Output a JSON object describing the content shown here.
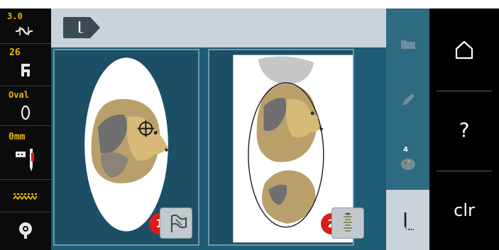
{
  "sidebar": {
    "items": [
      {
        "value": "3.0",
        "icon": "stitch-length-icon"
      },
      {
        "value": "26",
        "icon": "presser-foot-icon"
      },
      {
        "value": "Oval",
        "icon": "hoop-oval-icon"
      },
      {
        "value": "0mm",
        "icon": "needle-position-icon"
      },
      {
        "value": "",
        "icon": "feed-dog-icon"
      },
      {
        "value": "",
        "icon": "bobbin-icon"
      }
    ]
  },
  "right_column": {
    "badge_count": "4"
  },
  "panels": {
    "left": {
      "badge": "1",
      "button_icon": "flag-icon"
    },
    "right": {
      "badge": "2",
      "button_icon": "thread-cutter-icon"
    }
  },
  "commands": {
    "home_icon": "home-icon",
    "help_label": "?",
    "clear_label": "clr"
  },
  "colors": {
    "accent": "#f2b600",
    "main_bg": "#1f5c75",
    "badge": "#d91e18"
  }
}
